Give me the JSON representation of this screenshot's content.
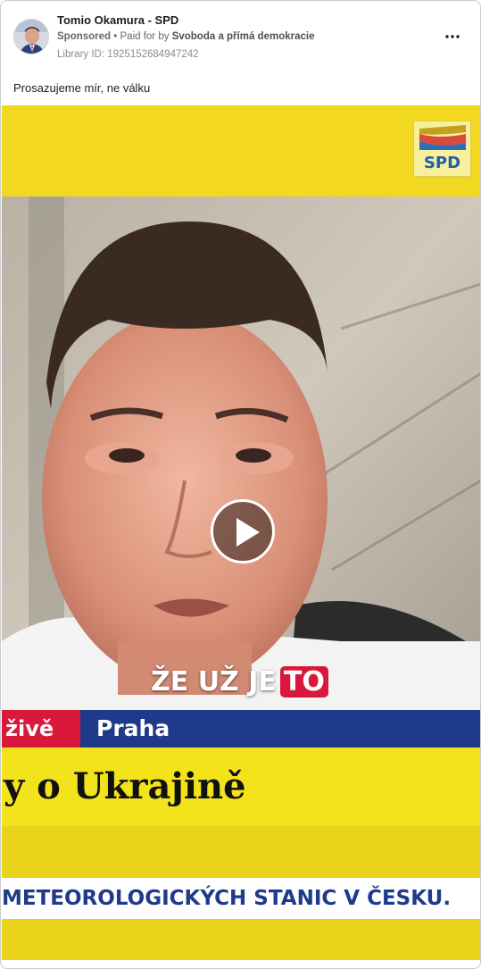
{
  "post": {
    "page_name": "Tomio Okamura - SPD",
    "sponsored_label": "Sponsored",
    "separator": "•",
    "paid_for_prefix": "Paid for by",
    "paid_for_by": "Svoboda a přímá demokracie",
    "library_id": "Library ID: 1925152684947242",
    "ad_text": "Prosazujeme mír, ne válku"
  },
  "video": {
    "logo_text": "SPD",
    "caption_main": "ŽE UŽ JE",
    "caption_highlight": "TO",
    "live_label": "živě",
    "location": "Praha",
    "headline": "y o Ukrajině",
    "ticker": "METEOROLOGICKÝCH STANIC V ČESKU."
  },
  "colors": {
    "broadcast_blue": "#1f3a8a",
    "broadcast_red": "#d9183b",
    "broadcast_yellow": "#f3e31b"
  },
  "icons": {
    "more": "more-options-icon",
    "play": "play-icon"
  }
}
